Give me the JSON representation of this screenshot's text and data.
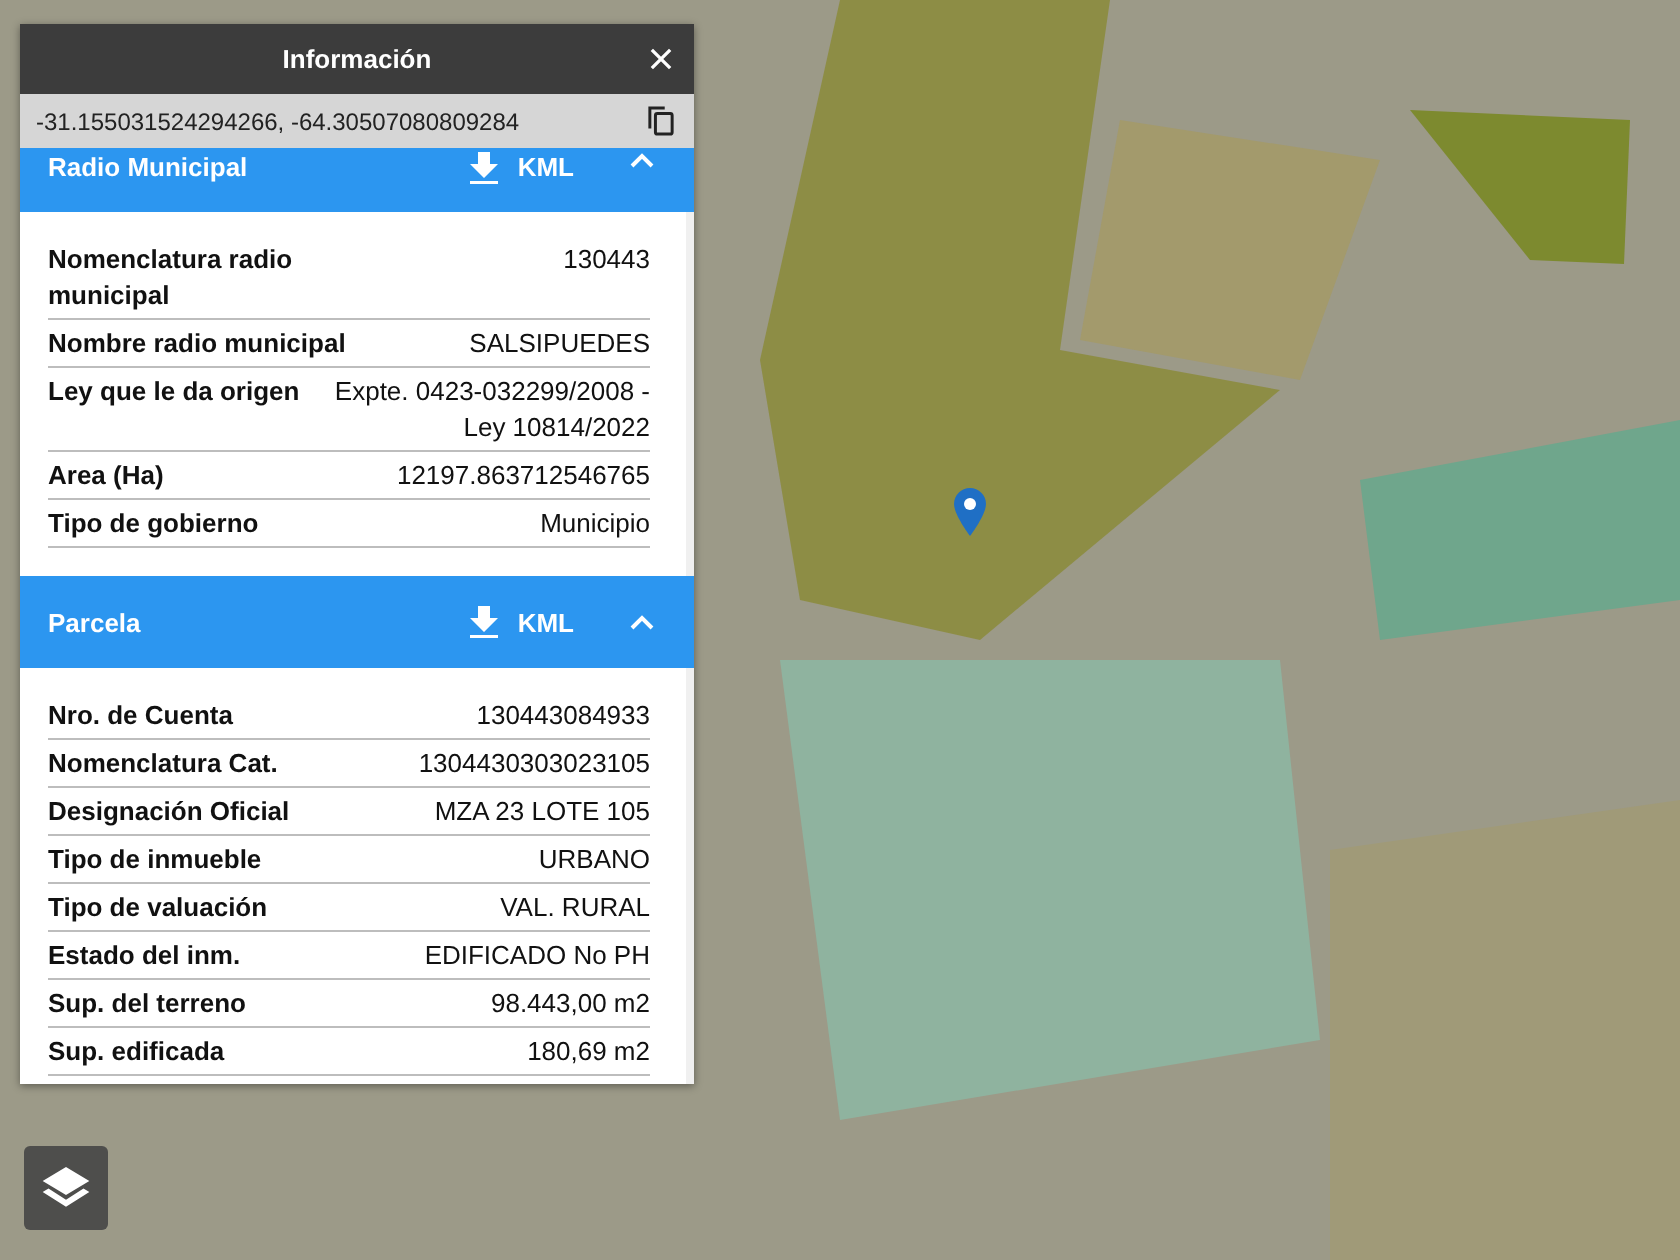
{
  "panel": {
    "title": "Información",
    "coordinates": "-31.155031524294266, -64.30507080809284",
    "sections": [
      {
        "title": "Radio Municipal",
        "download_label": "KML",
        "expanded": true,
        "rows": [
          {
            "label": "Nomenclatura radio municipal",
            "value": "130443"
          },
          {
            "label": "Nombre radio municipal",
            "value": "SALSIPUEDES"
          },
          {
            "label": "Ley que le da origen",
            "value": "Expte. 0423-032299/2008 - Ley 10814/2022"
          },
          {
            "label": "Area (Ha)",
            "value": "12197.863712546765"
          },
          {
            "label": "Tipo de gobierno",
            "value": "Municipio"
          }
        ]
      },
      {
        "title": "Parcela",
        "download_label": "KML",
        "expanded": true,
        "rows": [
          {
            "label": "Nro. de Cuenta",
            "value": "130443084933"
          },
          {
            "label": "Nomenclatura Cat.",
            "value": "1304430303023105"
          },
          {
            "label": "Designación Oficial",
            "value": "MZA 23 LOTE 105"
          },
          {
            "label": "Tipo de inmueble",
            "value": "URBANO"
          },
          {
            "label": "Tipo de valuación",
            "value": "VAL. RURAL"
          },
          {
            "label": "Estado del inm.",
            "value": "EDIFICADO No PH"
          },
          {
            "label": "Sup. del terreno",
            "value": "98.443,00 m2"
          },
          {
            "label": "Sup. edificada",
            "value": "180,69 m2"
          }
        ]
      }
    ]
  }
}
